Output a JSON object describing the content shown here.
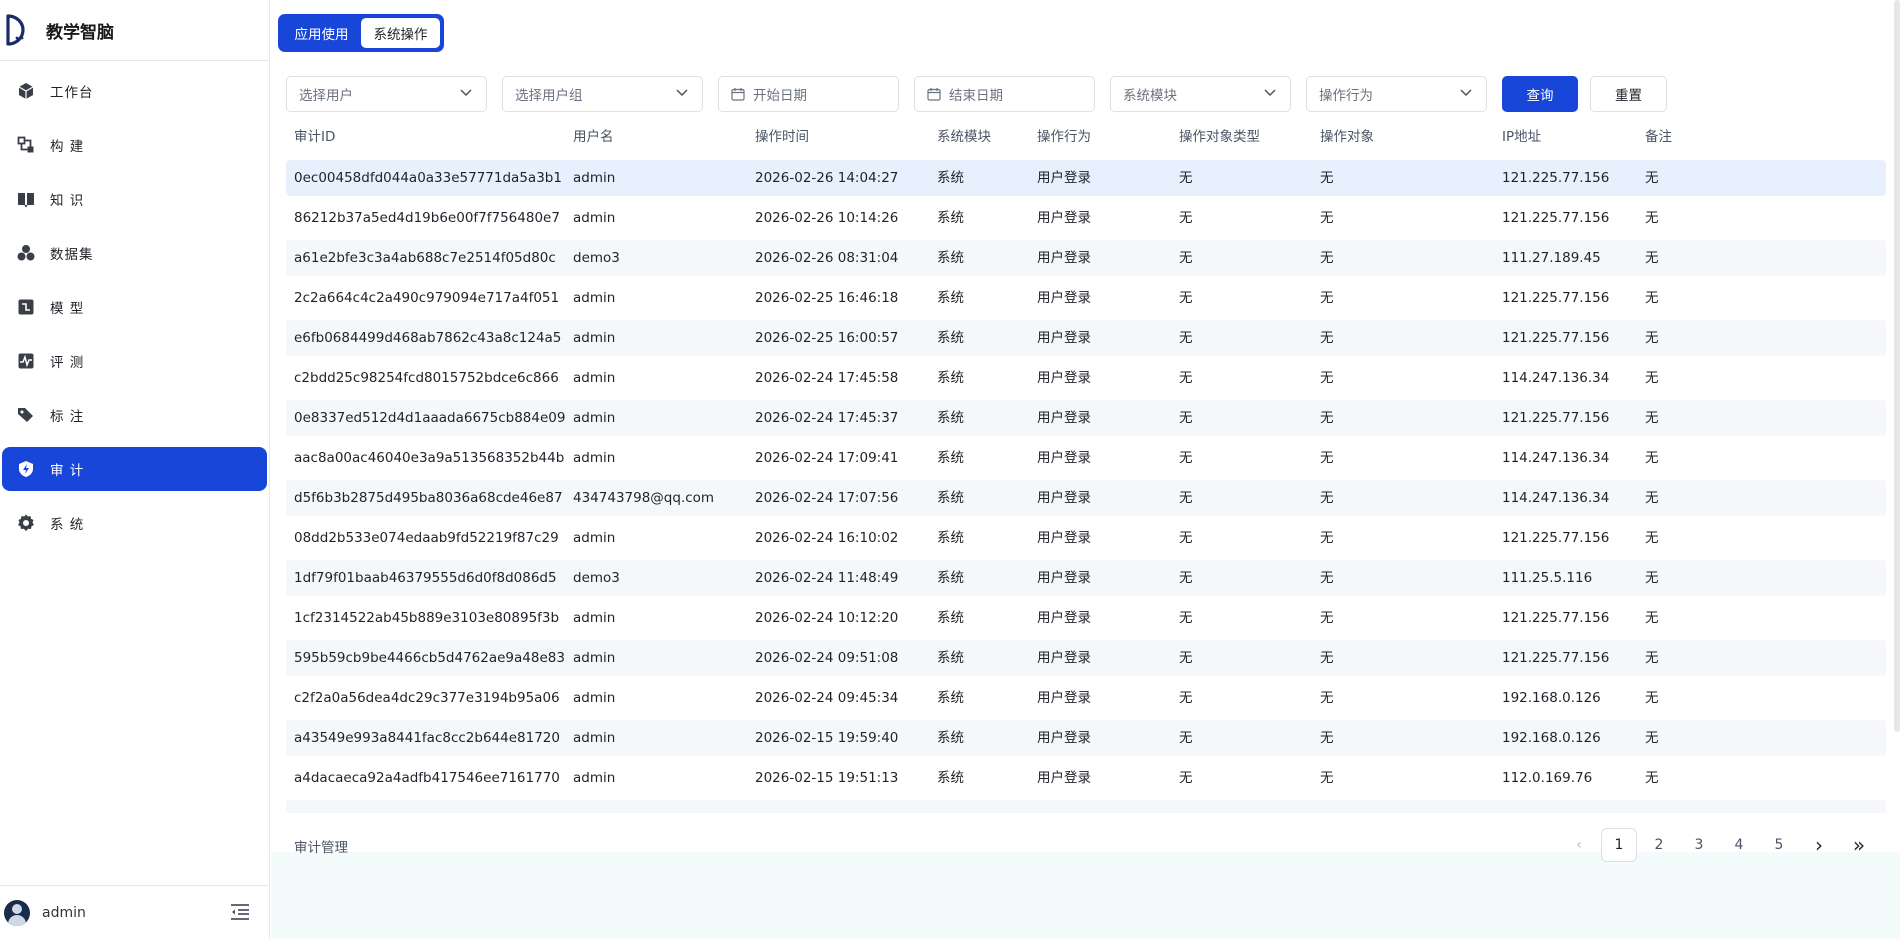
{
  "app": {
    "title": "教学智脑"
  },
  "sidebar": {
    "items": [
      {
        "label": "工作台",
        "icon": "cube-icon"
      },
      {
        "label": "构 建",
        "icon": "build-icon"
      },
      {
        "label": "知 识",
        "icon": "book-icon"
      },
      {
        "label": "数据集",
        "icon": "dataset-icon"
      },
      {
        "label": "模 型",
        "icon": "model-icon"
      },
      {
        "label": "评 测",
        "icon": "pulse-icon"
      },
      {
        "label": "标 注",
        "icon": "tag-icon"
      },
      {
        "label": "审 计",
        "icon": "shield-icon",
        "active": true
      },
      {
        "label": "系 统",
        "icon": "gear-icon"
      }
    ],
    "user": "admin"
  },
  "segment": {
    "app_use": "应用使用",
    "sys_op": "系统操作"
  },
  "filters": {
    "user": "选择用户",
    "group": "选择用户组",
    "start": "开始日期",
    "end": "结束日期",
    "module": "系统模块",
    "action": "操作行为",
    "query": "查询",
    "reset": "重置"
  },
  "table": {
    "headers": [
      "审计ID",
      "用户名",
      "操作时间",
      "系统模块",
      "操作行为",
      "操作对象类型",
      "操作对象",
      "IP地址",
      "备注"
    ],
    "rows": [
      [
        "0ec00458dfd044a0a33e57771da5a3b1",
        "admin",
        "2026-02-26 14:04:27",
        "系统",
        "用户登录",
        "无",
        "无",
        "121.225.77.156",
        "无"
      ],
      [
        "86212b37a5ed4d19b6e00f7f756480e7",
        "admin",
        "2026-02-26 10:14:26",
        "系统",
        "用户登录",
        "无",
        "无",
        "121.225.77.156",
        "无"
      ],
      [
        "a61e2bfe3c3a4ab688c7e2514f05d80c",
        "demo3",
        "2026-02-26 08:31:04",
        "系统",
        "用户登录",
        "无",
        "无",
        "111.27.189.45",
        "无"
      ],
      [
        "2c2a664c4c2a490c979094e717a4f051",
        "admin",
        "2026-02-25 16:46:18",
        "系统",
        "用户登录",
        "无",
        "无",
        "121.225.77.156",
        "无"
      ],
      [
        "e6fb0684499d468ab7862c43a8c124a5",
        "admin",
        "2026-02-25 16:00:57",
        "系统",
        "用户登录",
        "无",
        "无",
        "121.225.77.156",
        "无"
      ],
      [
        "c2bdd25c98254fcd8015752bdce6c866",
        "admin",
        "2026-02-24 17:45:58",
        "系统",
        "用户登录",
        "无",
        "无",
        "114.247.136.34",
        "无"
      ],
      [
        "0e8337ed512d4d1aaada6675cb884e09",
        "admin",
        "2026-02-24 17:45:37",
        "系统",
        "用户登录",
        "无",
        "无",
        "121.225.77.156",
        "无"
      ],
      [
        "aac8a00ac46040e3a9a513568352b44b",
        "admin",
        "2026-02-24 17:09:41",
        "系统",
        "用户登录",
        "无",
        "无",
        "114.247.136.34",
        "无"
      ],
      [
        "d5f6b3b2875d495ba8036a68cde46e87",
        "434743798@qq.com",
        "2026-02-24 17:07:56",
        "系统",
        "用户登录",
        "无",
        "无",
        "114.247.136.34",
        "无"
      ],
      [
        "08dd2b533e074edaab9fd52219f87c29",
        "admin",
        "2026-02-24 16:10:02",
        "系统",
        "用户登录",
        "无",
        "无",
        "121.225.77.156",
        "无"
      ],
      [
        "1df79f01baab46379555d6d0f8d086d5",
        "demo3",
        "2026-02-24 11:48:49",
        "系统",
        "用户登录",
        "无",
        "无",
        "111.25.5.116",
        "无"
      ],
      [
        "1cf2314522ab45b889e3103e80895f3b",
        "admin",
        "2026-02-24 10:12:20",
        "系统",
        "用户登录",
        "无",
        "无",
        "121.225.77.156",
        "无"
      ],
      [
        "595b59cb9be4466cb5d4762ae9a48e83",
        "admin",
        "2026-02-24 09:51:08",
        "系统",
        "用户登录",
        "无",
        "无",
        "121.225.77.156",
        "无"
      ],
      [
        "c2f2a0a56dea4dc29c377e3194b95a06",
        "admin",
        "2026-02-24 09:45:34",
        "系统",
        "用户登录",
        "无",
        "无",
        "192.168.0.126",
        "无"
      ],
      [
        "a43549e993a8441fac8cc2b644e81720",
        "admin",
        "2026-02-15 19:59:40",
        "系统",
        "用户登录",
        "无",
        "无",
        "192.168.0.126",
        "无"
      ],
      [
        "a4dacaeca92a4adfb417546ee7161770",
        "admin",
        "2026-02-15 19:51:13",
        "系统",
        "用户登录",
        "无",
        "无",
        "112.0.169.76",
        "无"
      ]
    ]
  },
  "footer": {
    "label": "审计管理"
  },
  "pagination": {
    "pages": [
      "1",
      "2",
      "3",
      "4",
      "5"
    ],
    "current": "1",
    "prev": "‹",
    "next": "›",
    "last": "»"
  },
  "colors": {
    "primary": "#1846d9",
    "row_alt": "#f5f7fa",
    "row_selected": "#e8effd"
  }
}
